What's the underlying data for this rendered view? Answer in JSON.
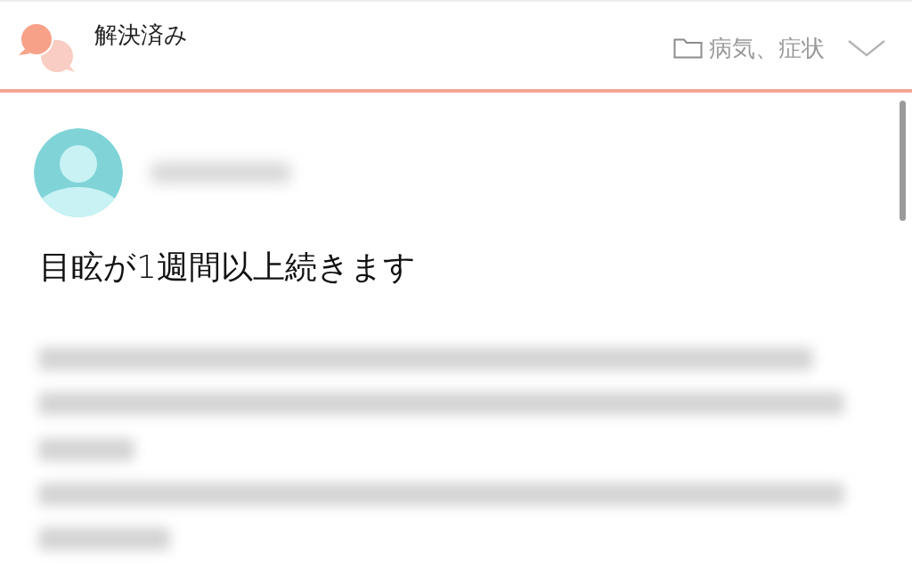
{
  "header": {
    "status": "解決済み",
    "category": "病気、症状"
  },
  "post": {
    "title": "目眩が1週間以上続きます"
  }
}
